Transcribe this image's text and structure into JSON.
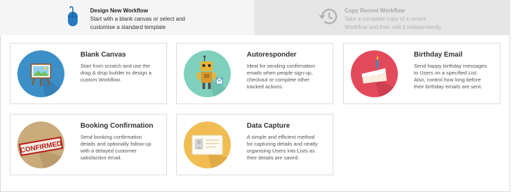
{
  "tabs": [
    {
      "title": "Design New Workflow",
      "desc_line1": "Start with a blank canvas or select and",
      "desc_line2": "customise a standard template",
      "icon": "mouse-icon",
      "active": true
    },
    {
      "title": "Copy Recent Workflow",
      "desc_line1": "Take a complete copy of a recent",
      "desc_line2": "Workflow and then edit it independently",
      "icon": "history-icon",
      "active": false
    }
  ],
  "cards": [
    {
      "title": "Blank Canvas",
      "lines": [
        "Start from scratch and use the",
        "drag & drop builder to design a",
        "custom Workflow."
      ],
      "icon": "easel-icon",
      "color": "#3d8fc7"
    },
    {
      "title": "Autoresponder",
      "lines": [
        "Ideal for sending confirmation",
        "emails when people sign-up,",
        "checkout or complete other",
        "tracked actions."
      ],
      "icon": "robot-icon",
      "color": "#7fd1be"
    },
    {
      "title": "Birthday Email",
      "lines": [
        "Send happy birthday messages",
        "to Users on a specified List.",
        "Also, control how long before",
        "their birthday emails are sent."
      ],
      "icon": "cake-icon",
      "color": "#e24a5c"
    },
    {
      "title": "Booking Confirmation",
      "lines": [
        "Send booking confirmation",
        "details and optionally follow-up",
        "with a delayed customer",
        "satisfaction email."
      ],
      "icon": "confirmed-stamp-icon",
      "stamp_text": "CONFIRMED",
      "color": "#c9ab7c"
    },
    {
      "title": "Data Capture",
      "lines": [
        "A simple and efficient method",
        "for capturing details and neatly",
        "organising Users into Lists as",
        "their details are saved."
      ],
      "icon": "id-card-icon",
      "color": "#f1bd52"
    }
  ]
}
